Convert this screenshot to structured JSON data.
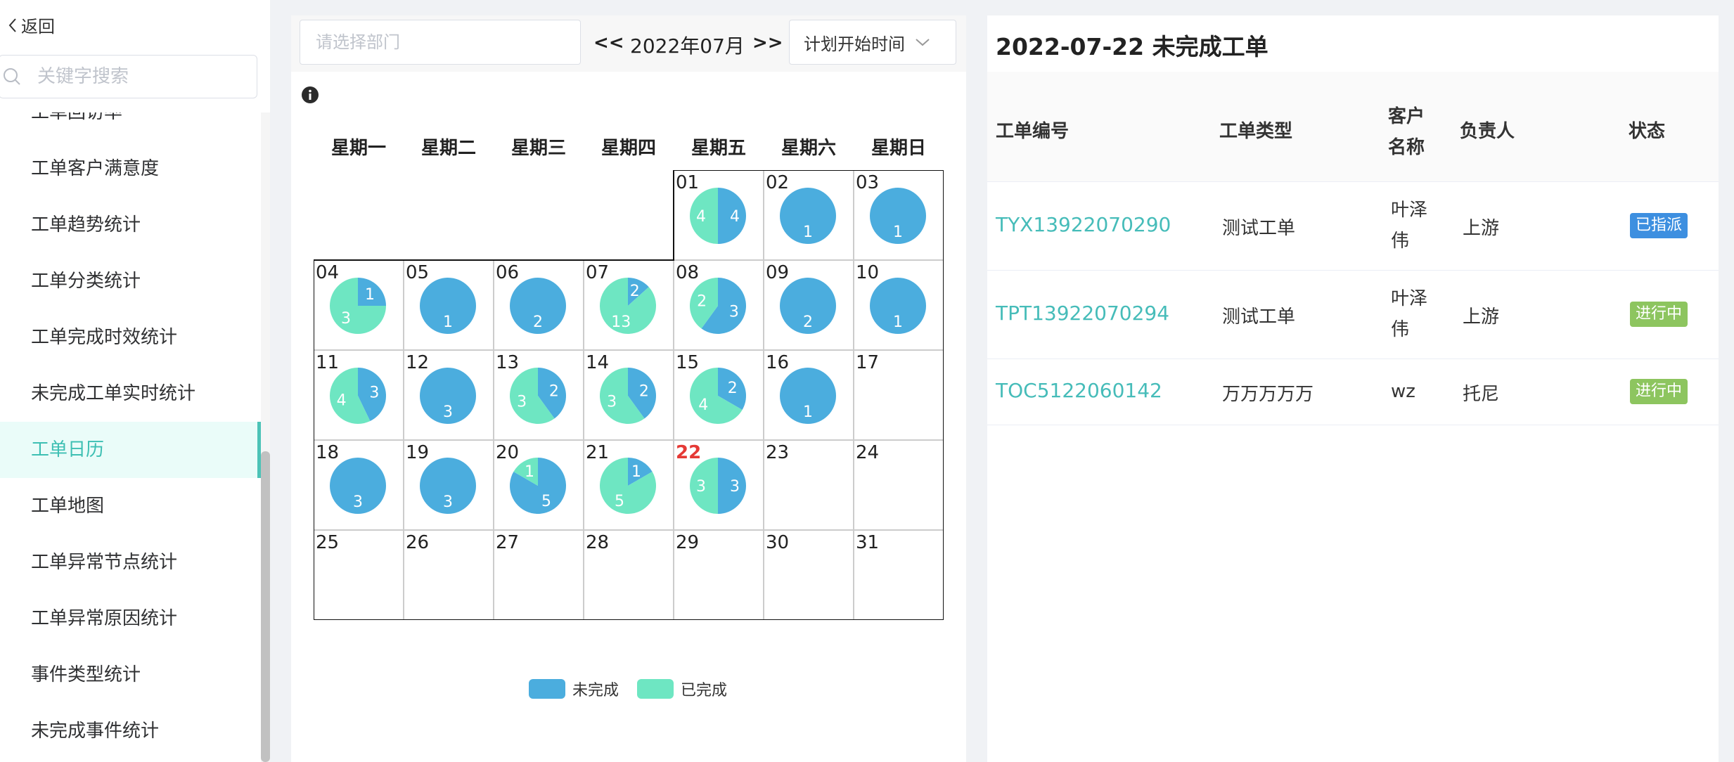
{
  "sidebar": {
    "back_label": "返回",
    "search_placeholder": "关键字搜索",
    "items": [
      "工单回访率",
      "工单客户满意度",
      "工单趋势统计",
      "工单分类统计",
      "工单完成时效统计",
      "未完成工单实时统计",
      "工单日历",
      "工单地图",
      "工单异常节点统计",
      "工单异常原因统计",
      "事件类型统计",
      "未完成事件统计"
    ],
    "active_item": "工单日历"
  },
  "toolbar": {
    "dept_placeholder": "请选择部门",
    "prev": "<<",
    "month": "2022年07月",
    "next": ">>",
    "time_filter": "计划开始时间"
  },
  "weekdays": [
    "星期一",
    "星期二",
    "星期三",
    "星期四",
    "星期五",
    "星期六",
    "星期日"
  ],
  "chart_data": {
    "type": "pie",
    "month": "2022-07",
    "series_names": [
      "未完成",
      "已完成"
    ],
    "colors": {
      "incomplete": "#4badde",
      "complete": "#6ee6c2"
    },
    "today": "22",
    "days": [
      {
        "day": "01",
        "incomplete": 4,
        "complete": 4
      },
      {
        "day": "02",
        "incomplete": 1,
        "complete": 0
      },
      {
        "day": "03",
        "incomplete": 1,
        "complete": 0
      },
      {
        "day": "04",
        "incomplete": 1,
        "complete": 3
      },
      {
        "day": "05",
        "incomplete": 1,
        "complete": 0
      },
      {
        "day": "06",
        "incomplete": 2,
        "complete": 0
      },
      {
        "day": "07",
        "incomplete": 2,
        "complete": 13
      },
      {
        "day": "08",
        "incomplete": 3,
        "complete": 2
      },
      {
        "day": "09",
        "incomplete": 2,
        "complete": 0
      },
      {
        "day": "10",
        "incomplete": 1,
        "complete": 0
      },
      {
        "day": "11",
        "incomplete": 3,
        "complete": 4
      },
      {
        "day": "12",
        "incomplete": 3,
        "complete": 0
      },
      {
        "day": "13",
        "incomplete": 2,
        "complete": 3
      },
      {
        "day": "14",
        "incomplete": 2,
        "complete": 3
      },
      {
        "day": "15",
        "incomplete": 2,
        "complete": 4
      },
      {
        "day": "16",
        "incomplete": 1,
        "complete": 0
      },
      {
        "day": "17",
        "incomplete": 0,
        "complete": 0
      },
      {
        "day": "18",
        "incomplete": 3,
        "complete": 0
      },
      {
        "day": "19",
        "incomplete": 3,
        "complete": 0
      },
      {
        "day": "20",
        "incomplete": 5,
        "complete": 1
      },
      {
        "day": "21",
        "incomplete": 1,
        "complete": 5
      },
      {
        "day": "22",
        "incomplete": 3,
        "complete": 3
      },
      {
        "day": "23",
        "incomplete": 0,
        "complete": 0
      },
      {
        "day": "24",
        "incomplete": 0,
        "complete": 0
      },
      {
        "day": "25",
        "incomplete": 0,
        "complete": 0
      },
      {
        "day": "26",
        "incomplete": 0,
        "complete": 0
      },
      {
        "day": "27",
        "incomplete": 0,
        "complete": 0
      },
      {
        "day": "28",
        "incomplete": 0,
        "complete": 0
      },
      {
        "day": "29",
        "incomplete": 0,
        "complete": 0
      },
      {
        "day": "30",
        "incomplete": 0,
        "complete": 0
      },
      {
        "day": "31",
        "incomplete": 0,
        "complete": 0
      }
    ]
  },
  "legend": {
    "incomplete": "未完成",
    "complete": "已完成"
  },
  "detail": {
    "title": "2022-07-22 未完成工单",
    "columns": [
      "工单编号",
      "工单类型",
      "客户名称",
      "负责人",
      "状态"
    ],
    "customer_header_lines": [
      "客户",
      "名称"
    ],
    "rows": [
      {
        "id": "TYX13922070290",
        "type": "测试工单",
        "customer_lines": [
          "叶泽",
          "伟"
        ],
        "owner": "上游",
        "status": "已指派",
        "status_color": "#3d8fe0"
      },
      {
        "id": "TPT13922070294",
        "type": "测试工单",
        "customer_lines": [
          "叶泽",
          "伟"
        ],
        "owner": "上游",
        "status": "进行中",
        "status_color": "#8dc55f"
      },
      {
        "id": "TOC5122060142",
        "type": "万万万万万",
        "customer_lines": [
          "wz"
        ],
        "owner": "托尼",
        "status": "进行中",
        "status_color": "#8dc55f"
      }
    ]
  }
}
